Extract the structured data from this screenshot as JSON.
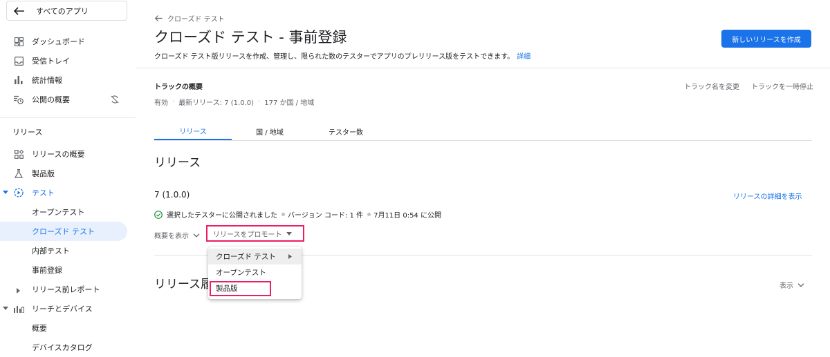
{
  "sidebar": {
    "all_apps": "すべてのアプリ",
    "top_items": [
      {
        "label": "ダッシュボード",
        "icon": "dashboard-icon"
      },
      {
        "label": "受信トレイ",
        "icon": "inbox-icon"
      },
      {
        "label": "統計情報",
        "icon": "bar-chart-icon"
      },
      {
        "label": "公開の概要",
        "icon": "publishing-overview-icon"
      }
    ],
    "release_section": "リリース",
    "release_items": [
      {
        "label": "リリースの概要"
      },
      {
        "label": "製品版"
      },
      {
        "label": "テスト"
      },
      {
        "label": "オープンテスト"
      },
      {
        "label": "クローズド テスト"
      },
      {
        "label": "内部テスト"
      },
      {
        "label": "事前登録"
      },
      {
        "label": "リリース前レポート"
      },
      {
        "label": "リーチとデバイス"
      },
      {
        "label": "概要"
      },
      {
        "label": "デバイスカタログ"
      }
    ]
  },
  "header": {
    "breadcrumb": "クローズド テスト",
    "title": "クローズド テスト - 事前登録",
    "description": "クローズド テスト版リリースを作成、管理し、限られた数のテスターでアプリのプレリリース版をテストできます。",
    "details_link": "詳細",
    "create_button": "新しいリリースを作成"
  },
  "track": {
    "label": "トラックの概要",
    "status": "有効",
    "latest_release": "最新リリース: 7 (1.0.0)",
    "countries": "177 か国 / 地域",
    "rename": "トラック名を変更",
    "pause": "トラックを一時停止"
  },
  "tabs": [
    "リリース",
    "国 / 地域",
    "テスター数"
  ],
  "releases": {
    "heading": "リリース",
    "version": "7 (1.0.0)",
    "details_link": "リリースの詳細を表示",
    "status": "選択したテスターに公開されました",
    "version_code": "バージョン コード: 1 件",
    "published": "7月11日 0:54 に公開",
    "summary_toggle": "概要を表示",
    "promote": "リリースをプロモート"
  },
  "history": {
    "heading": "リリース履",
    "show": "表示"
  },
  "promote_menu": {
    "items": [
      "クローズド テスト",
      "オープンテスト",
      "製品版"
    ]
  },
  "colors": {
    "accent": "#1a73e8",
    "highlight": "#e91e63",
    "success": "#1e8e3e"
  }
}
